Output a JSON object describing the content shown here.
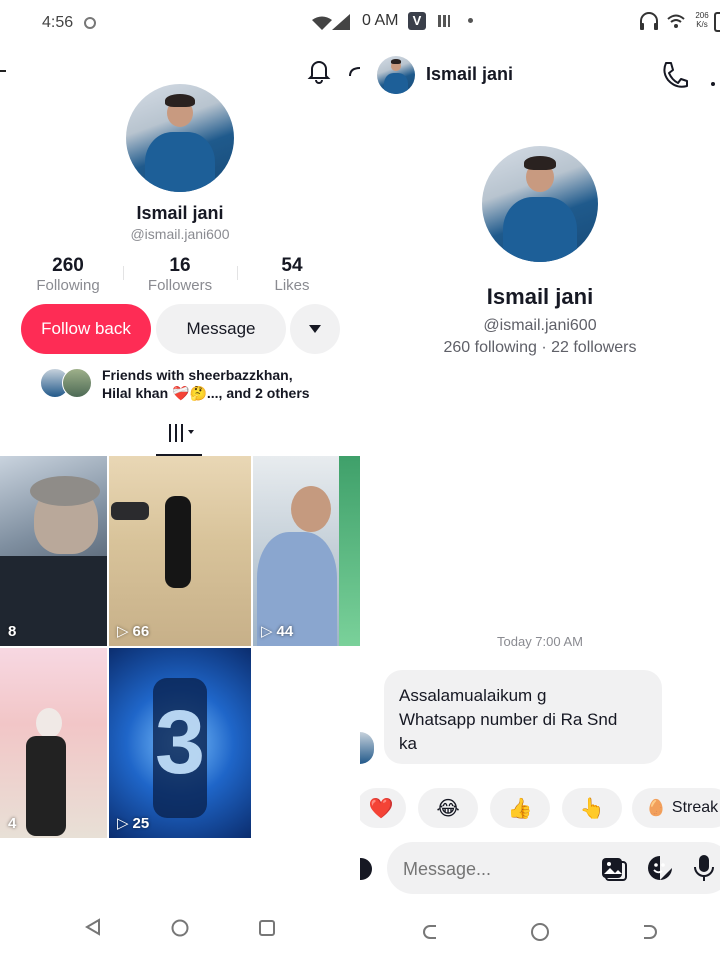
{
  "left": {
    "status": {
      "time": "4:56"
    },
    "profile": {
      "name": "Ismail jani",
      "username": "@ismail.jani600",
      "stats": [
        {
          "value": "260",
          "label": "Following"
        },
        {
          "value": "16",
          "label": "Followers"
        },
        {
          "value": "54",
          "label": "Likes"
        }
      ],
      "follow_back": "Follow back",
      "message": "Message",
      "friends_line1": "Friends with sheerbazzkhan,",
      "friends_line2": "Hilal khan ❤️‍🩹🤔..., and 2 others"
    },
    "videos": [
      {
        "views": "8"
      },
      {
        "views": "66"
      },
      {
        "views": "44"
      },
      {
        "views": "4"
      },
      {
        "views": "25"
      }
    ]
  },
  "right": {
    "status": {
      "time": "0 AM",
      "speed_top": "206",
      "speed_bottom": "K/s"
    },
    "header": {
      "name": "Ismail jani"
    },
    "profile": {
      "name": "Ismail jani",
      "username": "@ismail.jani600",
      "counts": "260 following · 22 followers"
    },
    "chat": {
      "timestamp": "Today 7:00 AM",
      "message_line1": "Assalamualaikum g",
      "message_line2": "Whatsapp number di Ra Snd",
      "message_line3": "ka"
    },
    "reactions": [
      "❤️",
      "😂",
      "👍",
      "👆",
      "Streak"
    ],
    "input": {
      "placeholder": "Message..."
    }
  },
  "colors": {
    "accent": "#fe2c55",
    "bubble": "#f1f1f2",
    "muted": "#8a8b91"
  }
}
